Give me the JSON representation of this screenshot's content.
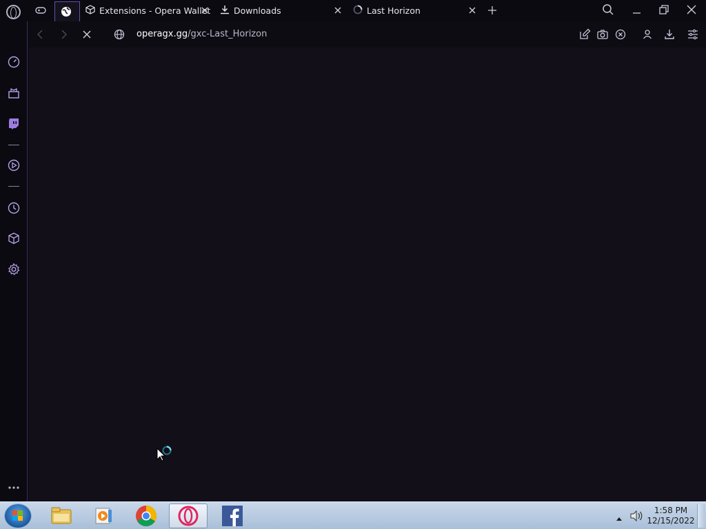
{
  "browser": {
    "tabs": [
      {
        "label": "Extensions - Opera Wallet"
      },
      {
        "label": "Downloads"
      },
      {
        "label": "Last Horizon"
      }
    ],
    "url": {
      "domain": "operagx.gg",
      "path": "/gxc-Last_Horizon"
    }
  },
  "taskbar": {
    "clock_time": "1:58 PM",
    "clock_date": "12/15/2022",
    "apps": [
      "windows-explorer",
      "media-player",
      "chrome",
      "opera-gx",
      "facebook"
    ]
  },
  "colors": {
    "accent": "#7b5cd6",
    "background": "#120f18",
    "taskbar": "#b9cce0"
  }
}
